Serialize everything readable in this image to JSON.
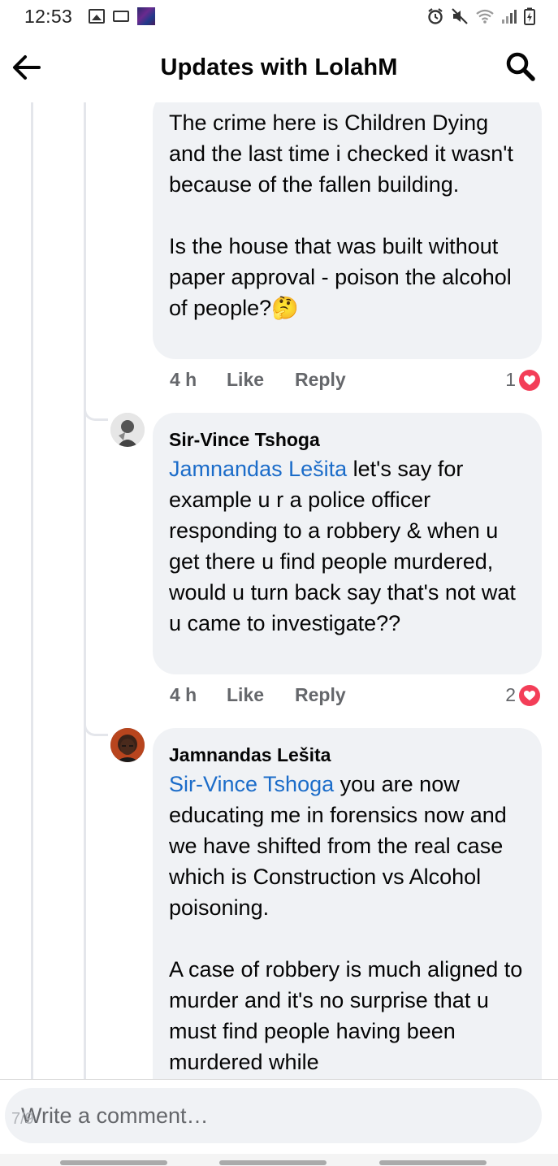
{
  "status_bar": {
    "time": "12:53",
    "left_icons": [
      "gallery-icon",
      "cast-icon",
      "app-thumbnail-icon"
    ],
    "right_icons": [
      "alarm-icon",
      "mute-icon",
      "wifi-icon",
      "signal-icon",
      "battery-icon"
    ]
  },
  "header": {
    "title": "Updates with LolahM"
  },
  "comments": [
    {
      "text": "The crime here is Children Dying and the last time i checked it wasn't because of the fallen building.\n\nIs the house that was built without paper approval - poison the alcohol of people?",
      "emoji": "🤔",
      "time": "4 h",
      "like": "Like",
      "reply": "Reply",
      "reaction_count": "1"
    },
    {
      "author": "Sir-Vince Tshoga",
      "mention": "Jamnandas Lešita",
      "text": " let's say for example u r a police officer responding to a robbery & when u get there u find people murdered, would u turn back say that's not wat u came to investigate??",
      "time": "4 h",
      "like": "Like",
      "reply": "Reply",
      "reaction_count": "2"
    },
    {
      "author": "Jamnandas Lešita",
      "mention": "Sir-Vince Tshoga",
      "text": " you are now educating me in forensics now and we have shifted from the real case which is Construction vs Alcohol poisoning.\n\nA case of robbery is much aligned to murder and it's no surprise that u must find people having been murdered while"
    }
  ],
  "composer": {
    "placeholder": "Write a comment…",
    "overlay_text": "7/9"
  },
  "colors": {
    "mention": "#1b6cc9",
    "bubble": "#f0f2f5",
    "heart": "#f33e58",
    "meta_text": "#65676b"
  }
}
